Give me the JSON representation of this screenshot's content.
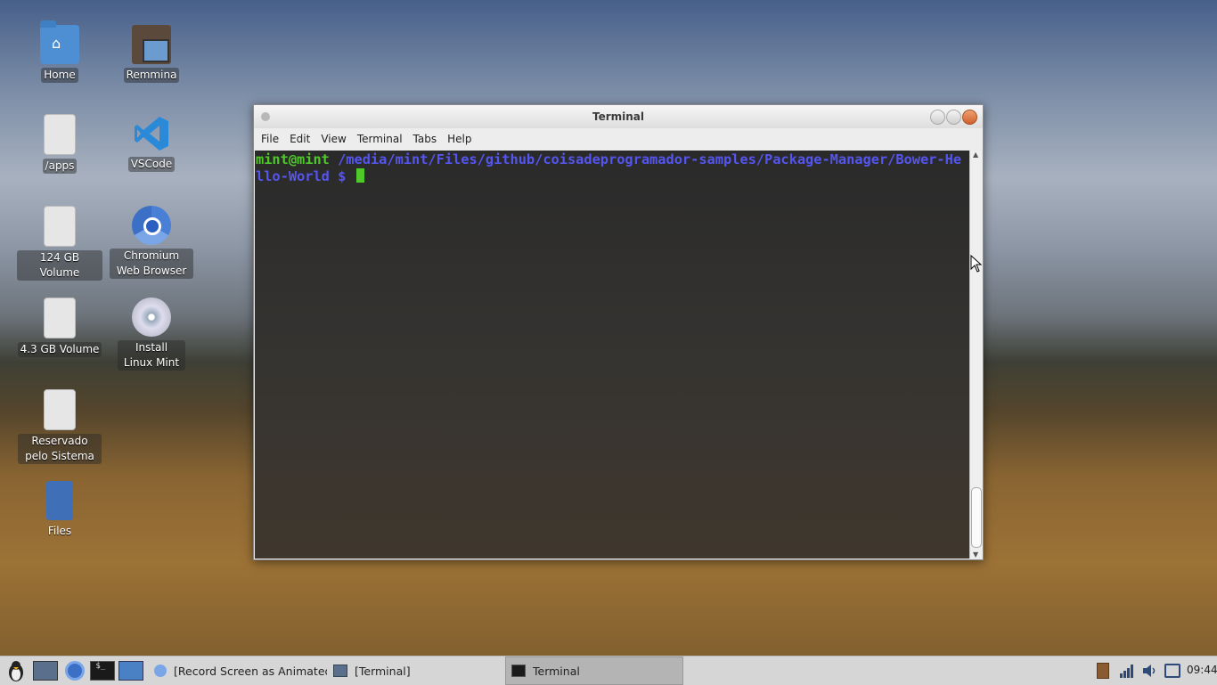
{
  "desktop": {
    "icons": [
      {
        "label": "Home",
        "icon": "home-folder-icon"
      },
      {
        "label": "Remmina",
        "icon": "remmina-icon"
      },
      {
        "label": "/apps",
        "icon": "drive-icon"
      },
      {
        "label": "VSCode",
        "icon": "vscode-icon"
      },
      {
        "label": "124 GB Volume",
        "icon": "drive-icon"
      },
      {
        "label": "Chromium Web Browser",
        "icon": "chromium-icon"
      },
      {
        "label": "4.3 GB Volume",
        "icon": "drive-icon"
      },
      {
        "label": "Install Linux Mint",
        "icon": "install-disc-icon"
      },
      {
        "label": "Reservado pelo Sistema",
        "icon": "drive-icon"
      },
      {
        "label": "Files",
        "icon": "usb-files-icon"
      }
    ]
  },
  "terminal": {
    "title": "Terminal",
    "menu": [
      "File",
      "Edit",
      "View",
      "Terminal",
      "Tabs",
      "Help"
    ],
    "prompt_user": "mint@mint",
    "prompt_path": " /media/mint/Files/github/coisadeprogramador-samples/Package-Manager/Bower-Hello-World $ "
  },
  "taskbar": {
    "tasks": [
      {
        "label": "[Record Screen as Animated...",
        "icon": "chromium-icon",
        "active": false
      },
      {
        "label": "[Terminal]",
        "icon": "window-icon",
        "active": false
      },
      {
        "label": "Terminal",
        "icon": "terminal-icon",
        "active": true
      }
    ],
    "clock": "09:44"
  },
  "colors": {
    "prompt_user": "#4ec929",
    "prompt_path": "#5555f0",
    "taskbar": "#d6d6d6"
  }
}
